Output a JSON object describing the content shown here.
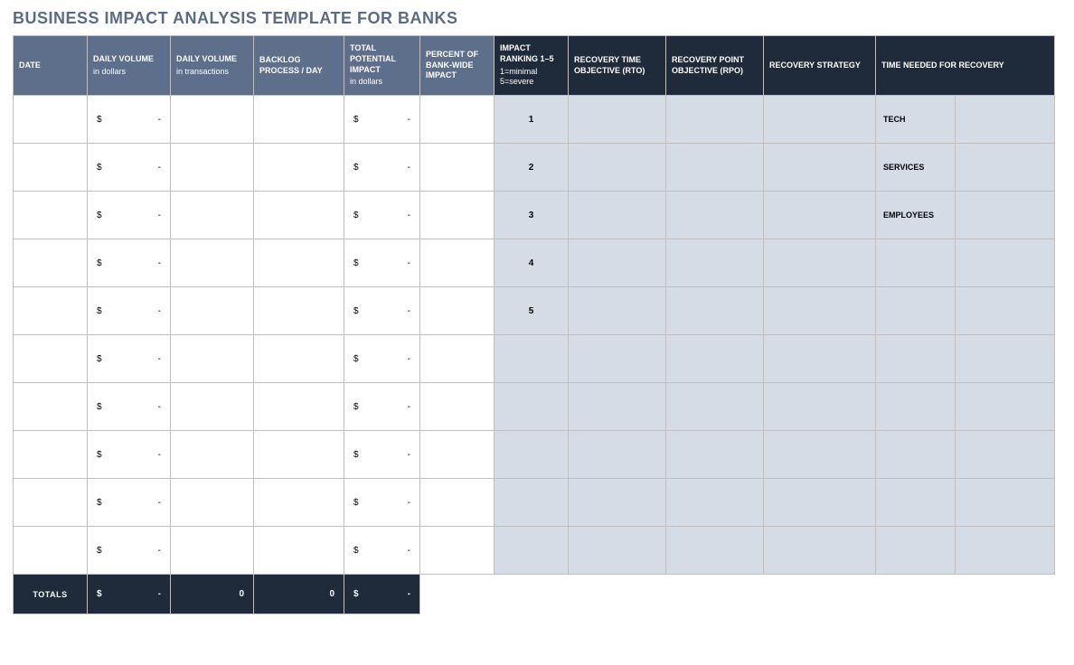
{
  "title": "BUSINESS IMPACT ANALYSIS TEMPLATE FOR BANKS",
  "headers": {
    "date": "DATE",
    "daily_vol_dollars": "DAILY VOLUME",
    "daily_vol_dollars_sub": "in dollars",
    "daily_vol_tx": "DAILY VOLUME",
    "daily_vol_tx_sub": "in transactions",
    "backlog": "BACKLOG PROCESS / DAY",
    "total_potential": "TOTAL POTENTIAL IMPACT",
    "total_potential_sub": "in dollars",
    "percent_bankwide": "PERCENT OF BANK-WIDE IMPACT",
    "impact_ranking": "IMPACT RANKING 1–5",
    "impact_ranking_sub": "1=minimal 5=severe",
    "rto": "RECOVERY TIME OBJECTIVE (RTO)",
    "rpo": "RECOVERY POINT OBJECTIVE (RPO)",
    "recovery_strategy": "RECOVERY STRATEGY",
    "time_needed": "TIME NEEDED FOR RECOVERY"
  },
  "money_symbol": "$",
  "money_dash": "-",
  "rows": [
    {
      "impact_rank": "1",
      "recovery_label": "TECH"
    },
    {
      "impact_rank": "2",
      "recovery_label": "SERVICES"
    },
    {
      "impact_rank": "3",
      "recovery_label": "EMPLOYEES"
    },
    {
      "impact_rank": "4",
      "recovery_label": ""
    },
    {
      "impact_rank": "5",
      "recovery_label": ""
    },
    {
      "impact_rank": "",
      "recovery_label": ""
    },
    {
      "impact_rank": "",
      "recovery_label": ""
    },
    {
      "impact_rank": "",
      "recovery_label": ""
    },
    {
      "impact_rank": "",
      "recovery_label": ""
    },
    {
      "impact_rank": "",
      "recovery_label": ""
    }
  ],
  "totals": {
    "label": "TOTALS",
    "daily_vol_tx": "0",
    "backlog": "0"
  }
}
